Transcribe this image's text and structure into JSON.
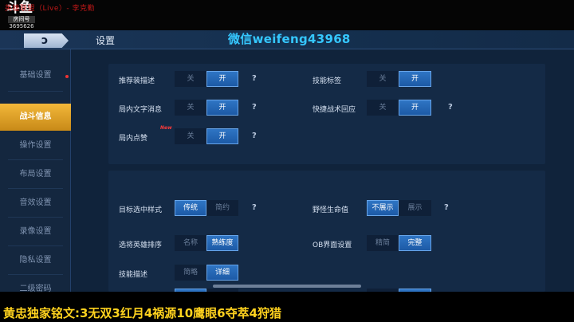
{
  "stream": {
    "logo_brand": "斗鱼",
    "logo_room_label": "房间号",
    "room_number": "3695626",
    "title": "英雄联盟（Live）- 李克勤"
  },
  "game": {
    "settings_title": "设置",
    "watermark": "微信weifeng43968",
    "back_glyph": "ↄ"
  },
  "sidebar": {
    "items": [
      {
        "label": "基础设置",
        "active": false
      },
      {
        "label": "战斗信息",
        "active": true
      },
      {
        "label": "操作设置",
        "active": false
      },
      {
        "label": "布局设置",
        "active": false
      },
      {
        "label": "音效设置",
        "active": false
      },
      {
        "label": "录像设置",
        "active": false
      },
      {
        "label": "隐私设置",
        "active": false
      },
      {
        "label": "二级密码",
        "active": false
      }
    ]
  },
  "settings": {
    "recommend_desc": {
      "label": "推荐装描述",
      "off": "关",
      "on": "开",
      "selected": "on"
    },
    "skill_tag": {
      "label": "技能标签",
      "off": "关",
      "on": "开",
      "selected": "on"
    },
    "ingame_text": {
      "label": "局内文字消息",
      "off": "关",
      "on": "开",
      "selected": "on"
    },
    "quick_reply": {
      "label": "快捷战术回应",
      "off": "关",
      "on": "开",
      "selected": "on"
    },
    "ingame_like": {
      "label": "局内点赞",
      "badge": "New",
      "off": "关",
      "on": "开",
      "selected": "on"
    },
    "target_style": {
      "label": "目标选中样式",
      "a": "传统",
      "b": "简约",
      "selected": "a"
    },
    "monster_hp": {
      "label": "野怪生命值",
      "a": "不展示",
      "b": "展示",
      "selected": "a"
    },
    "hero_sort": {
      "label": "选将英雄排序",
      "a": "名称",
      "b": "熟练度",
      "selected": "b"
    },
    "ob_ui": {
      "label": "OB界面设置",
      "a": "精简",
      "b": "完整",
      "selected": "b"
    },
    "skill_desc": {
      "label": "技能描述",
      "a": "简略",
      "b": "详细",
      "selected": "b"
    },
    "partial_row_left": {
      "on": "关",
      "off": "开"
    },
    "partial_row_right": {
      "off": "关",
      "on": "开"
    },
    "help": "?"
  },
  "caption": "黄忠独家铭文:3无双3红月4祸源10鹰眼6夺萃4狩猎"
}
